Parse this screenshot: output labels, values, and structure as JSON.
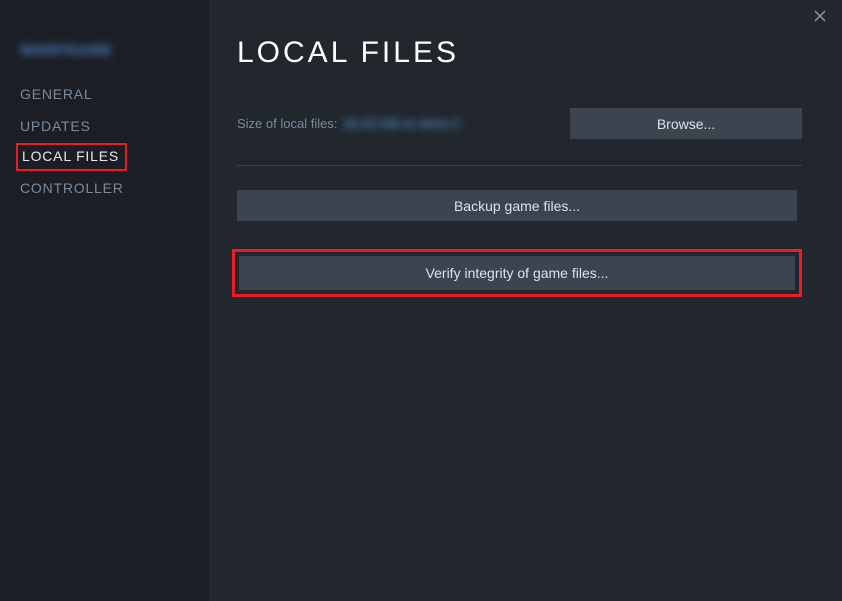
{
  "game_title": "WARFRAME",
  "sidebar": {
    "items": [
      {
        "label": "GENERAL"
      },
      {
        "label": "UPDATES"
      },
      {
        "label": "LOCAL FILES"
      },
      {
        "label": "CONTROLLER"
      }
    ]
  },
  "main": {
    "heading": "LOCAL FILES",
    "size_label": "Size of local files:",
    "size_value": "26.43 GB on drive C",
    "browse_label": "Browse...",
    "backup_label": "Backup game files...",
    "verify_label": "Verify integrity of game files..."
  }
}
